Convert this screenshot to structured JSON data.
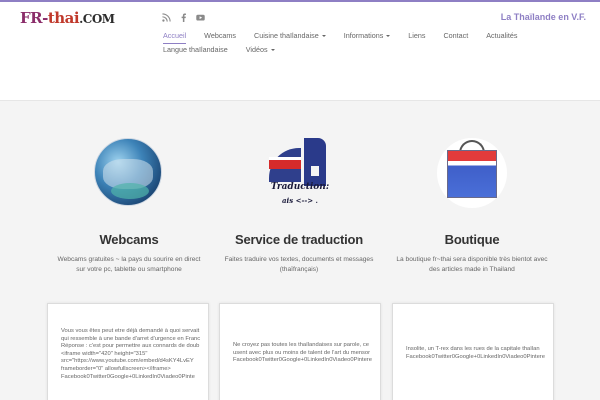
{
  "header": {
    "logo": {
      "part1": "FR-",
      "part2": "thai",
      "part3": ".COM"
    },
    "tagline": "La Thaïlande en V.F.",
    "social_icons": [
      "rss-icon",
      "facebook-icon",
      "youtube-icon"
    ]
  },
  "nav": {
    "items": [
      {
        "label": "Accueil",
        "active": true,
        "dropdown": false
      },
      {
        "label": "Webcams",
        "active": false,
        "dropdown": false
      },
      {
        "label": "Cuisine thaïlandaise",
        "active": false,
        "dropdown": true
      },
      {
        "label": "Informations",
        "active": false,
        "dropdown": true
      },
      {
        "label": "Liens",
        "active": false,
        "dropdown": false
      },
      {
        "label": "Contact",
        "active": false,
        "dropdown": false
      },
      {
        "label": "Actualités",
        "active": false,
        "dropdown": false
      },
      {
        "label": "Langue thaïlandaise",
        "active": false,
        "dropdown": false
      },
      {
        "label": "Vidéos",
        "active": false,
        "dropdown": true
      }
    ]
  },
  "features": [
    {
      "title": "Webcams",
      "text": "Webcams gratuites ~ la pays du sourire en direct sur votre pc, tablette ou smartphone"
    },
    {
      "title": "Service de traduction",
      "text": "Faites traduire vos textes, documents et messages (thaïfrançais)",
      "image_caption_1": "Traduction:",
      "image_caption_2": "ais <--> ."
    },
    {
      "title": "Boutique",
      "text": "La boutique fr~thai sera disponible très bientot avec des articles made in Thailand"
    }
  ],
  "cards": [
    {
      "text": "Vous vous êtes peut etre déjà demandé à quoi servait\nqui ressemble à une bande d'arret d'urgence en Franc\nRéponse : c'est pour permettre aux connards de doub\n<iframe width=\"420\" height=\"315\"\nsrc=\"https://www.youtube.com/embed/d4sKY4LvEY\nframeborder=\"0\" allowfullscreen></iframe>\nFacebook0Twitter0Google+0LinkedIn0Viadeo0Pinte"
    },
    {
      "text": "Ne croyez pas toutes les thaïlandaises sur parole, ce\nusent avec plus ou moins de talent de l'art du mensor\nFacebook0Twitter0Google+0LinkedIn0Viadeo0Pintere"
    },
    {
      "text": "Insolite, un T-rex dans les rues de la capitale thaïlan\nFacebook0Twitter0Google+0LinkedIn0Viadeo0Pintere"
    }
  ],
  "colors": {
    "accent": "#8e7fc4",
    "logo_purple": "#8b2d6a",
    "logo_red": "#c0392b"
  }
}
